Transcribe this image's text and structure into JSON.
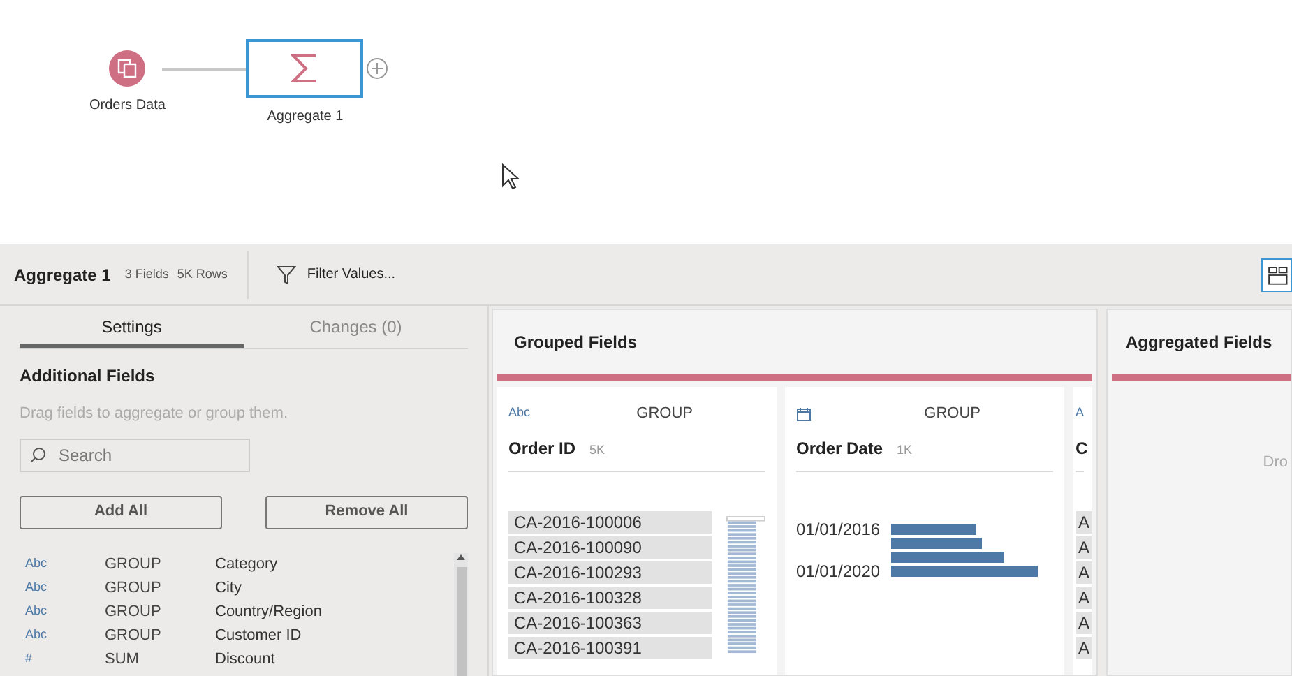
{
  "flow": {
    "nodes": [
      {
        "kind": "input",
        "label": "Orders Data",
        "selected": false
      },
      {
        "kind": "aggregate",
        "label": "Aggregate 1",
        "selected": true
      }
    ]
  },
  "toolbar": {
    "title": "Aggregate 1",
    "fields": "3 Fields",
    "rows": "5K Rows",
    "filter": "Filter Values..."
  },
  "settings": {
    "tabs": [
      {
        "label": "Settings",
        "selected": true
      },
      {
        "label": "Changes (0)",
        "selected": false
      }
    ],
    "heading": "Additional Fields",
    "hint": "Drag fields to aggregate or group them.",
    "search": {
      "placeholder": "Search"
    },
    "buttons": [
      "Add All",
      "Remove All"
    ],
    "fields": [
      {
        "type": "Abc",
        "role": "GROUP",
        "name": "Category"
      },
      {
        "type": "Abc",
        "role": "GROUP",
        "name": "City"
      },
      {
        "type": "Abc",
        "role": "GROUP",
        "name": "Country/Region"
      },
      {
        "type": "Abc",
        "role": "GROUP",
        "name": "Customer ID"
      },
      {
        "type": "#",
        "role": "SUM",
        "name": "Discount"
      }
    ]
  },
  "grouped": {
    "title": "Grouped Fields",
    "cards": [
      {
        "kind": "text",
        "type": "Abc",
        "role": "GROUP",
        "name": "Order ID",
        "count": "5K",
        "values": [
          "CA-2016-100006",
          "CA-2016-100090",
          "CA-2016-100293",
          "CA-2016-100328",
          "CA-2016-100363",
          "CA-2016-100391"
        ]
      },
      {
        "kind": "date",
        "role": "GROUP",
        "name": "Order Date",
        "count": "1K",
        "axis_labels": [
          "01/01/2016",
          "01/01/2020"
        ]
      },
      {
        "kind": "text",
        "type": "A",
        "name": "C",
        "values": [
          "A",
          "A",
          "A",
          "A",
          "A",
          "A"
        ]
      }
    ]
  },
  "aggregated": {
    "title": "Aggregated Fields",
    "hint": "Dro"
  }
}
